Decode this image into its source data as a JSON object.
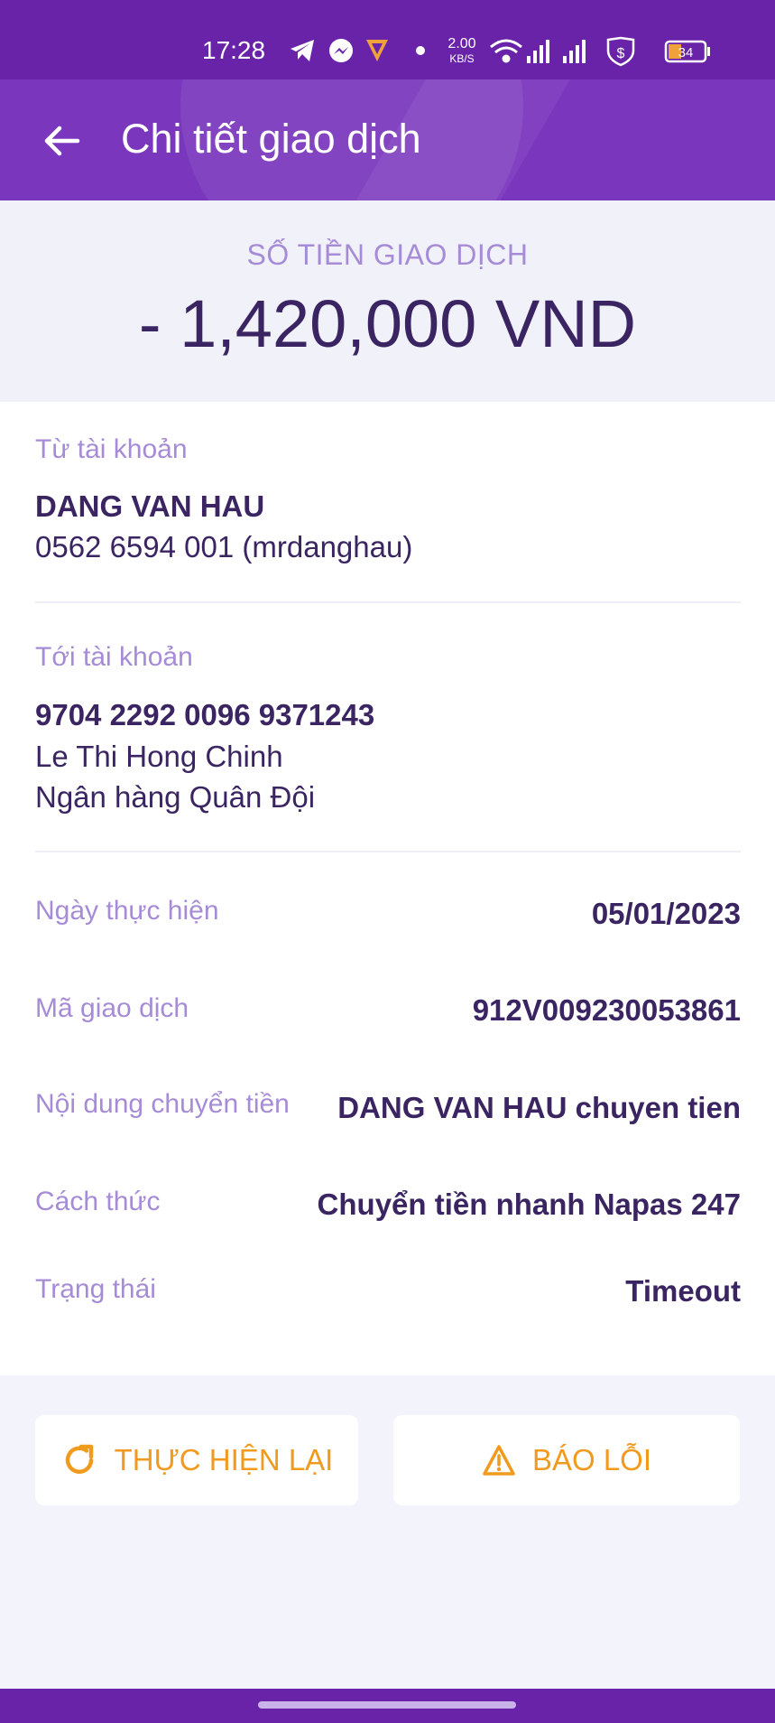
{
  "status_bar": {
    "time": "17:28",
    "net_speed_value": "2.00",
    "net_speed_unit": "KB/S",
    "battery": "34"
  },
  "header": {
    "title": "Chi tiết giao dịch"
  },
  "amount": {
    "label": "SỐ TIỀN GIAO DỊCH",
    "value": "- 1,420,000 VND"
  },
  "from_account": {
    "label": "Từ tài khoản",
    "name": "DANG VAN HAU",
    "number": "0562 6594 001 (mrdanghau)"
  },
  "to_account": {
    "label": "Tới tài khoản",
    "number": "9704 2292 0096 9371243",
    "name": "Le Thi Hong Chinh",
    "bank": "Ngân hàng Quân Đội"
  },
  "rows": [
    {
      "label": "Ngày thực hiện",
      "value": "05/01/2023"
    },
    {
      "label": "Mã giao dịch",
      "value": "912V009230053861"
    },
    {
      "label": "Nội dung chuyển tiền",
      "value": "DANG VAN HAU chuyen tien"
    },
    {
      "label": "Cách thức",
      "value": "Chuyển tiền nhanh Napas 247"
    },
    {
      "label": "Trạng thái",
      "value": "Timeout"
    }
  ],
  "actions": {
    "retry_label": "THỰC HIỆN LẠI",
    "report_label": "BÁO LỖI"
  },
  "colors": {
    "primary": "#7a36bd",
    "accent": "#f09b1d",
    "text": "#3a2562",
    "muted": "#a68bd6"
  }
}
